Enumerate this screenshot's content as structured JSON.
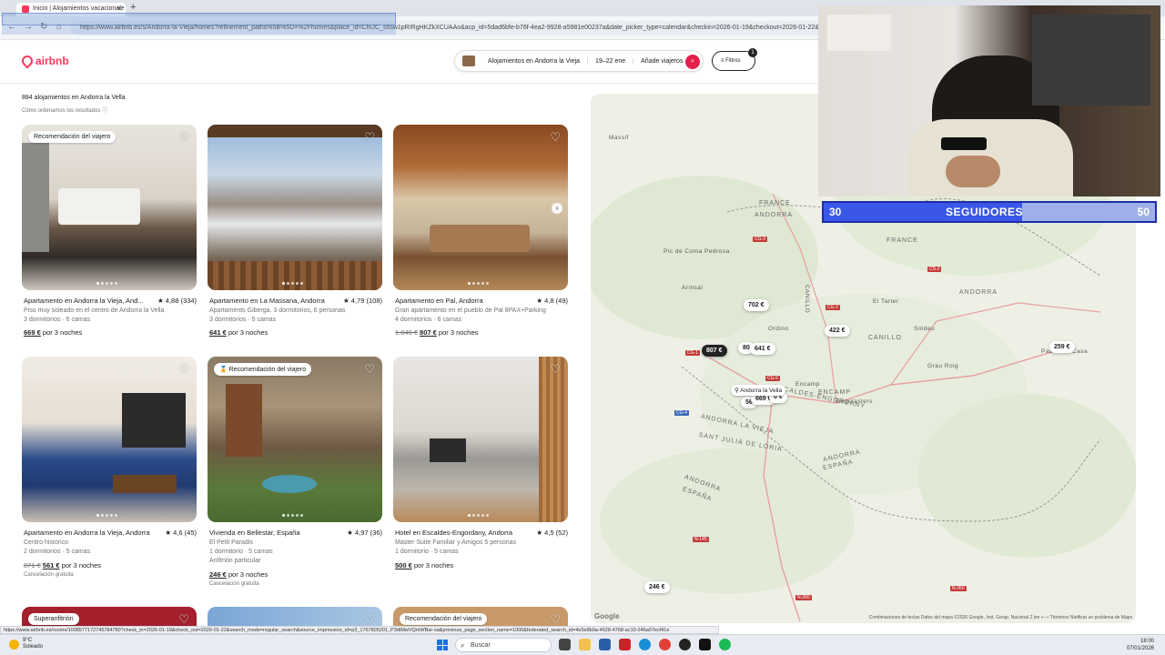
{
  "browser": {
    "tab_title": "Inicio | Alojamientos vacacionale",
    "url": "https://www.airbnb.es/s/Andorra-la-Vieja/homes?refinement_paths%5B%5D=%2Fhomes&place_id=ChIJC_s6sw1pRIRgHKZkXCUAAo&acp_id=5dad6bfe-b76f-4ea2-9928-a5981e00237a&date_picker_type=calendar&checkin=2026-01-19&checkout=2026-01-22&adults=1",
    "status_url": "https://www.airbnb.es/rooms/1008577172745784780?check_in=2026-01-19&check_out=2026-01-22&search_mode=regular_search&source_impression_id=p3_1767805201_P3dtMwVQmWBar-sa&previous_page_section_name=1000&federated_search_id=4e5e8b0a-4628-4768-ac10-246a07ecf41e"
  },
  "header": {
    "logo": "airbnb",
    "search_location": "Alojamientos en Andorra la Vieja",
    "search_dates": "19–22 ene",
    "search_guests": "Añade viajeros",
    "filters_label": "Filtros",
    "filters_count": "1"
  },
  "results": {
    "count_text": "884 alojamientos en Andorra la Vella",
    "order_text": "Cómo ordenamos los resultados"
  },
  "listings": [
    {
      "tag": "Recomendación del viajero",
      "title": "Apartamento en Andorra la Vieja, And...",
      "rating": "★ 4,88 (334)",
      "line1": "Piso muy soleado en el centro de Andorra la Vella",
      "line2": "3 dormitorios · 6 camas",
      "line3": "",
      "old_price": "",
      "price": "669 €",
      "price_suffix": "por 3 noches",
      "cancel": ""
    },
    {
      "tag": "",
      "title": "Apartamento en La Massana, Andorra",
      "rating": "★ 4,79 (108)",
      "line1": "Apartaments Giberga. 3 dormitorios, 6 personas",
      "line2": "3 dormitorios · 5 camas",
      "line3": "",
      "old_price": "",
      "price": "641 €",
      "price_suffix": "por 3 noches",
      "cancel": ""
    },
    {
      "tag": "",
      "title": "Apartamento en Pal, Andorra",
      "rating": "★ 4,8 (49)",
      "line1": "Gran apartamento en el pueblo de Pal 8PAX+Parking",
      "line2": "4 dormitorios · 6 camas",
      "line3": "",
      "old_price": "1.040 €",
      "price": "807 €",
      "price_suffix": "por 3 noches",
      "cancel": ""
    },
    {
      "tag": "",
      "title": "Apartamento en Andorra la Vieja, Andorra",
      "rating": "★ 4,6 (45)",
      "line1": "Centro histórico",
      "line2": "2 dormitorios · 5 camas",
      "line3": "",
      "old_price": "871 €",
      "price": "561 €",
      "price_suffix": "por 3 noches",
      "cancel": "Cancelación gratuita"
    },
    {
      "tag": "Recomendación del viajero",
      "title": "Vivienda en Bellestar, España",
      "rating": "★ 4,97 (36)",
      "line1": "El Petit Paradis",
      "line2": "1 dormitorio · 5 camas",
      "line3": "Anfitrión particular",
      "old_price": "",
      "price": "246 €",
      "price_suffix": "por 3 noches",
      "cancel": "Cancelación gratuita"
    },
    {
      "tag": "",
      "title": "Hotel en Escaldes-Engordany, Andorra",
      "rating": "★ 4,5 (52)",
      "line1": "Master Suite Familiar y Amigos 5 personas",
      "line2": "1 dormitorio · 5 camas",
      "line3": "",
      "old_price": "",
      "price": "500 €",
      "price_suffix": "por 3 noches",
      "cancel": ""
    }
  ],
  "bottom_tags": [
    "Superanfitrión",
    "Recomendación del viajero"
  ],
  "map": {
    "pins": [
      "702 €",
      "807 €",
      "80",
      "641 €",
      "422 €",
      "259 €",
      "56",
      "669 €",
      "0 €",
      "246 €"
    ],
    "town_pin": "Andorra la Vella",
    "labels": [
      "FRANCE",
      "ANDORRA",
      "FRANCE",
      "ANDORRA",
      "CANILLO",
      "CANILLO",
      "ENCAMP",
      "ESCALDES-ENGORDANY",
      "ANDORRA LA VIEJA",
      "SANT JULIÀ DE LÒRIA",
      "ANDORRA",
      "ESPAÑA",
      "ANDORRA",
      "ESPAÑA",
      "Pic de Coma Pedrosa",
      "Massif",
      "Engolasters",
      "El Tarter",
      "Soldeu",
      "Grau Roig",
      "Encamp",
      "Ordino",
      "Pas de la Casa",
      "Arinsal"
    ],
    "roads": [
      "CG-3",
      "CG-2",
      "CG-1",
      "CG-4",
      "CG-5",
      "CS-2",
      "N-145",
      "N-260",
      "N-260"
    ],
    "footer": "Combinaciones de teclas   Datos del mapa ©2026 Google, Inst. Geogr. Nacional   2 km ⊢⊣   Términos   Notificar un problema de Maps",
    "google": "Google"
  },
  "stream": {
    "followers_current": "30",
    "followers_label": "SEGUIDORES",
    "followers_goal": "50",
    "progress": 0.6
  },
  "taskbar": {
    "temp": "9°C",
    "weather": "Soleado",
    "search": "Buscar",
    "time": "18:00",
    "date": "07/01/2026"
  }
}
